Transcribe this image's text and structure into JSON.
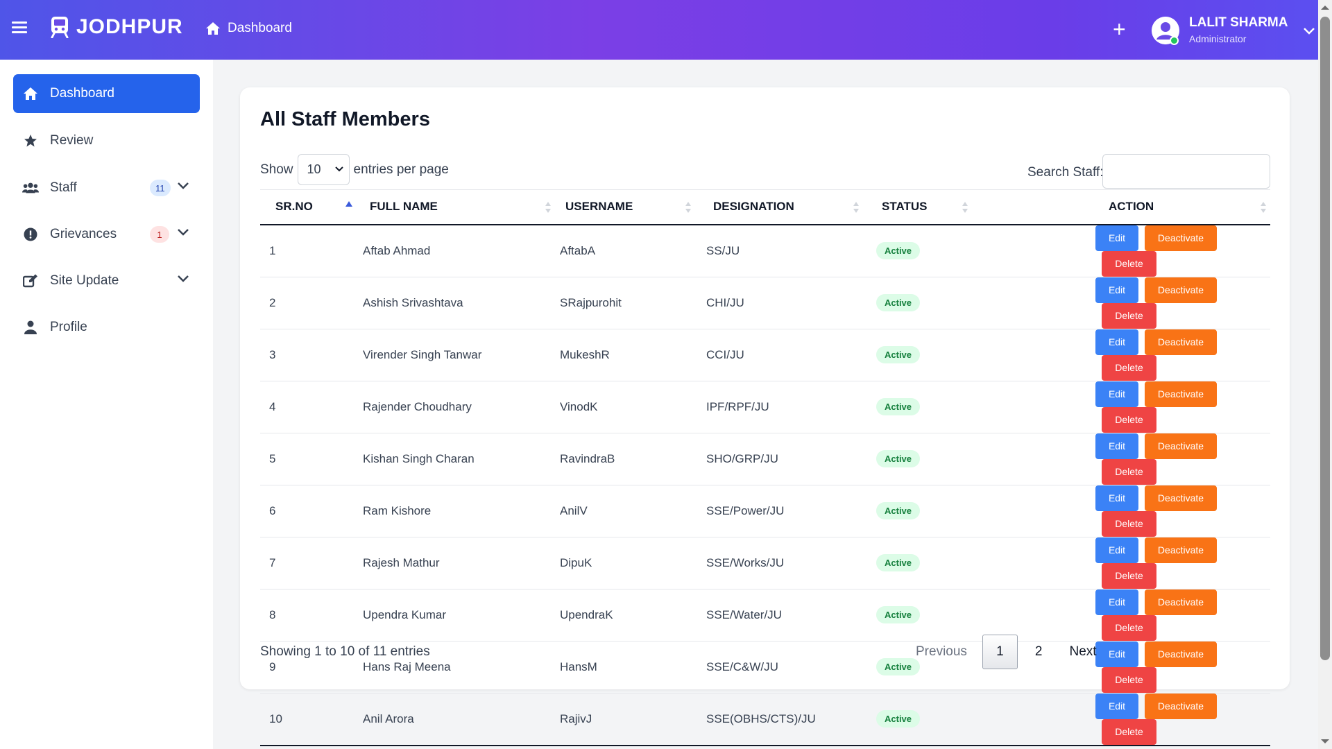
{
  "topbar": {
    "brand": "JODHPUR",
    "breadcrumb": "Dashboard",
    "add_button": "+",
    "user": {
      "name": "LALIT SHARMA",
      "role": "Administrator"
    }
  },
  "sidebar": {
    "items": [
      {
        "label": "Dashboard",
        "icon": "home-icon",
        "active": true
      },
      {
        "label": "Review",
        "icon": "star-icon"
      },
      {
        "label": "Staff",
        "icon": "users-icon",
        "badge": "11"
      },
      {
        "label": "Grievances",
        "icon": "alert-icon",
        "badge": "1"
      },
      {
        "label": "Site Update",
        "icon": "edit-icon"
      },
      {
        "label": "Profile",
        "icon": "user-icon"
      }
    ]
  },
  "main": {
    "title": "All Staff Members",
    "show_label": "Show",
    "entries_value": "10",
    "entries_suffix": "entries per page",
    "search_label": "Search Staff:",
    "search_value": "",
    "columns": [
      "SR.NO",
      "FULL NAME",
      "USERNAME",
      "DESIGNATION",
      "STATUS",
      "ACTION"
    ],
    "rows": [
      {
        "sr": "1",
        "name": "Aftab Ahmad",
        "username": "AftabA",
        "designation": "SS/JU",
        "status": "Active"
      },
      {
        "sr": "2",
        "name": "Ashish Srivashtava",
        "username": "SRajpurohit",
        "designation": "CHI/JU",
        "status": "Active"
      },
      {
        "sr": "3",
        "name": "Virender Singh Tanwar",
        "username": "MukeshR",
        "designation": "CCI/JU",
        "status": "Active"
      },
      {
        "sr": "4",
        "name": "Rajender Choudhary",
        "username": "VinodK",
        "designation": "IPF/RPF/JU",
        "status": "Active"
      },
      {
        "sr": "5",
        "name": "Kishan Singh Charan",
        "username": "RavindraB",
        "designation": "SHO/GRP/JU",
        "status": "Active"
      },
      {
        "sr": "6",
        "name": "Ram Kishore",
        "username": "AnilV",
        "designation": "SSE/Power/JU",
        "status": "Active"
      },
      {
        "sr": "7",
        "name": "Rajesh Mathur",
        "username": "DipuK",
        "designation": "SSE/Works/JU",
        "status": "Active"
      },
      {
        "sr": "8",
        "name": "Upendra Kumar",
        "username": "UpendraK",
        "designation": "SSE/Water/JU",
        "status": "Active"
      },
      {
        "sr": "9",
        "name": "Hans Raj Meena",
        "username": "HansM",
        "designation": "SSE/C&W/JU",
        "status": "Active"
      },
      {
        "sr": "10",
        "name": "Anil Arora",
        "username": "RajivJ",
        "designation": "SSE(OBHS/CTS)/JU",
        "status": "Active"
      }
    ],
    "actions": {
      "edit": "Edit",
      "deactivate": "Deactivate",
      "delete": "Delete"
    },
    "footer_info": "Showing 1 to 10 of 11 entries",
    "pagination": {
      "previous": "Previous",
      "current": "1",
      "page2": "2",
      "next": "Next"
    }
  },
  "colors": {
    "topbar_gradient": [
      "#4f55e8",
      "#7b3fe6",
      "#5b4ff0"
    ],
    "active_nav": "#2563eb",
    "edit": "#3b82f6",
    "deactivate": "#f97316",
    "delete": "#ef4444",
    "status_active_bg": "#dcfce7",
    "status_active_text": "#15803d"
  }
}
